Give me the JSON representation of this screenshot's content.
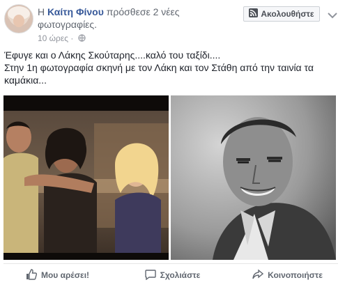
{
  "post": {
    "prefix": "Η",
    "author": "Καίτη Φίνου",
    "action": "πρόσθεσε 2 νέες",
    "action_line2": "φωτογραφίες.",
    "time": "10 ώρες ·",
    "follow_label": "Ακολουθήστε",
    "text_line1": "Έφυγε και ο Λάκης Σκούταρης....καλό του ταξίδι....",
    "text_line2": "Στην 1η φωτογραφία σκηνή με τον Λάκη και τον Στάθη από την ταινία τα",
    "text_line3": "καμάκια..."
  },
  "actions": {
    "like": "Μου αρέσει!",
    "comment": "Σχολιάστε",
    "share": "Κοινοποιήστε"
  },
  "colors": {
    "link": "#365899",
    "meta": "#616770",
    "text": "#1d2129"
  }
}
